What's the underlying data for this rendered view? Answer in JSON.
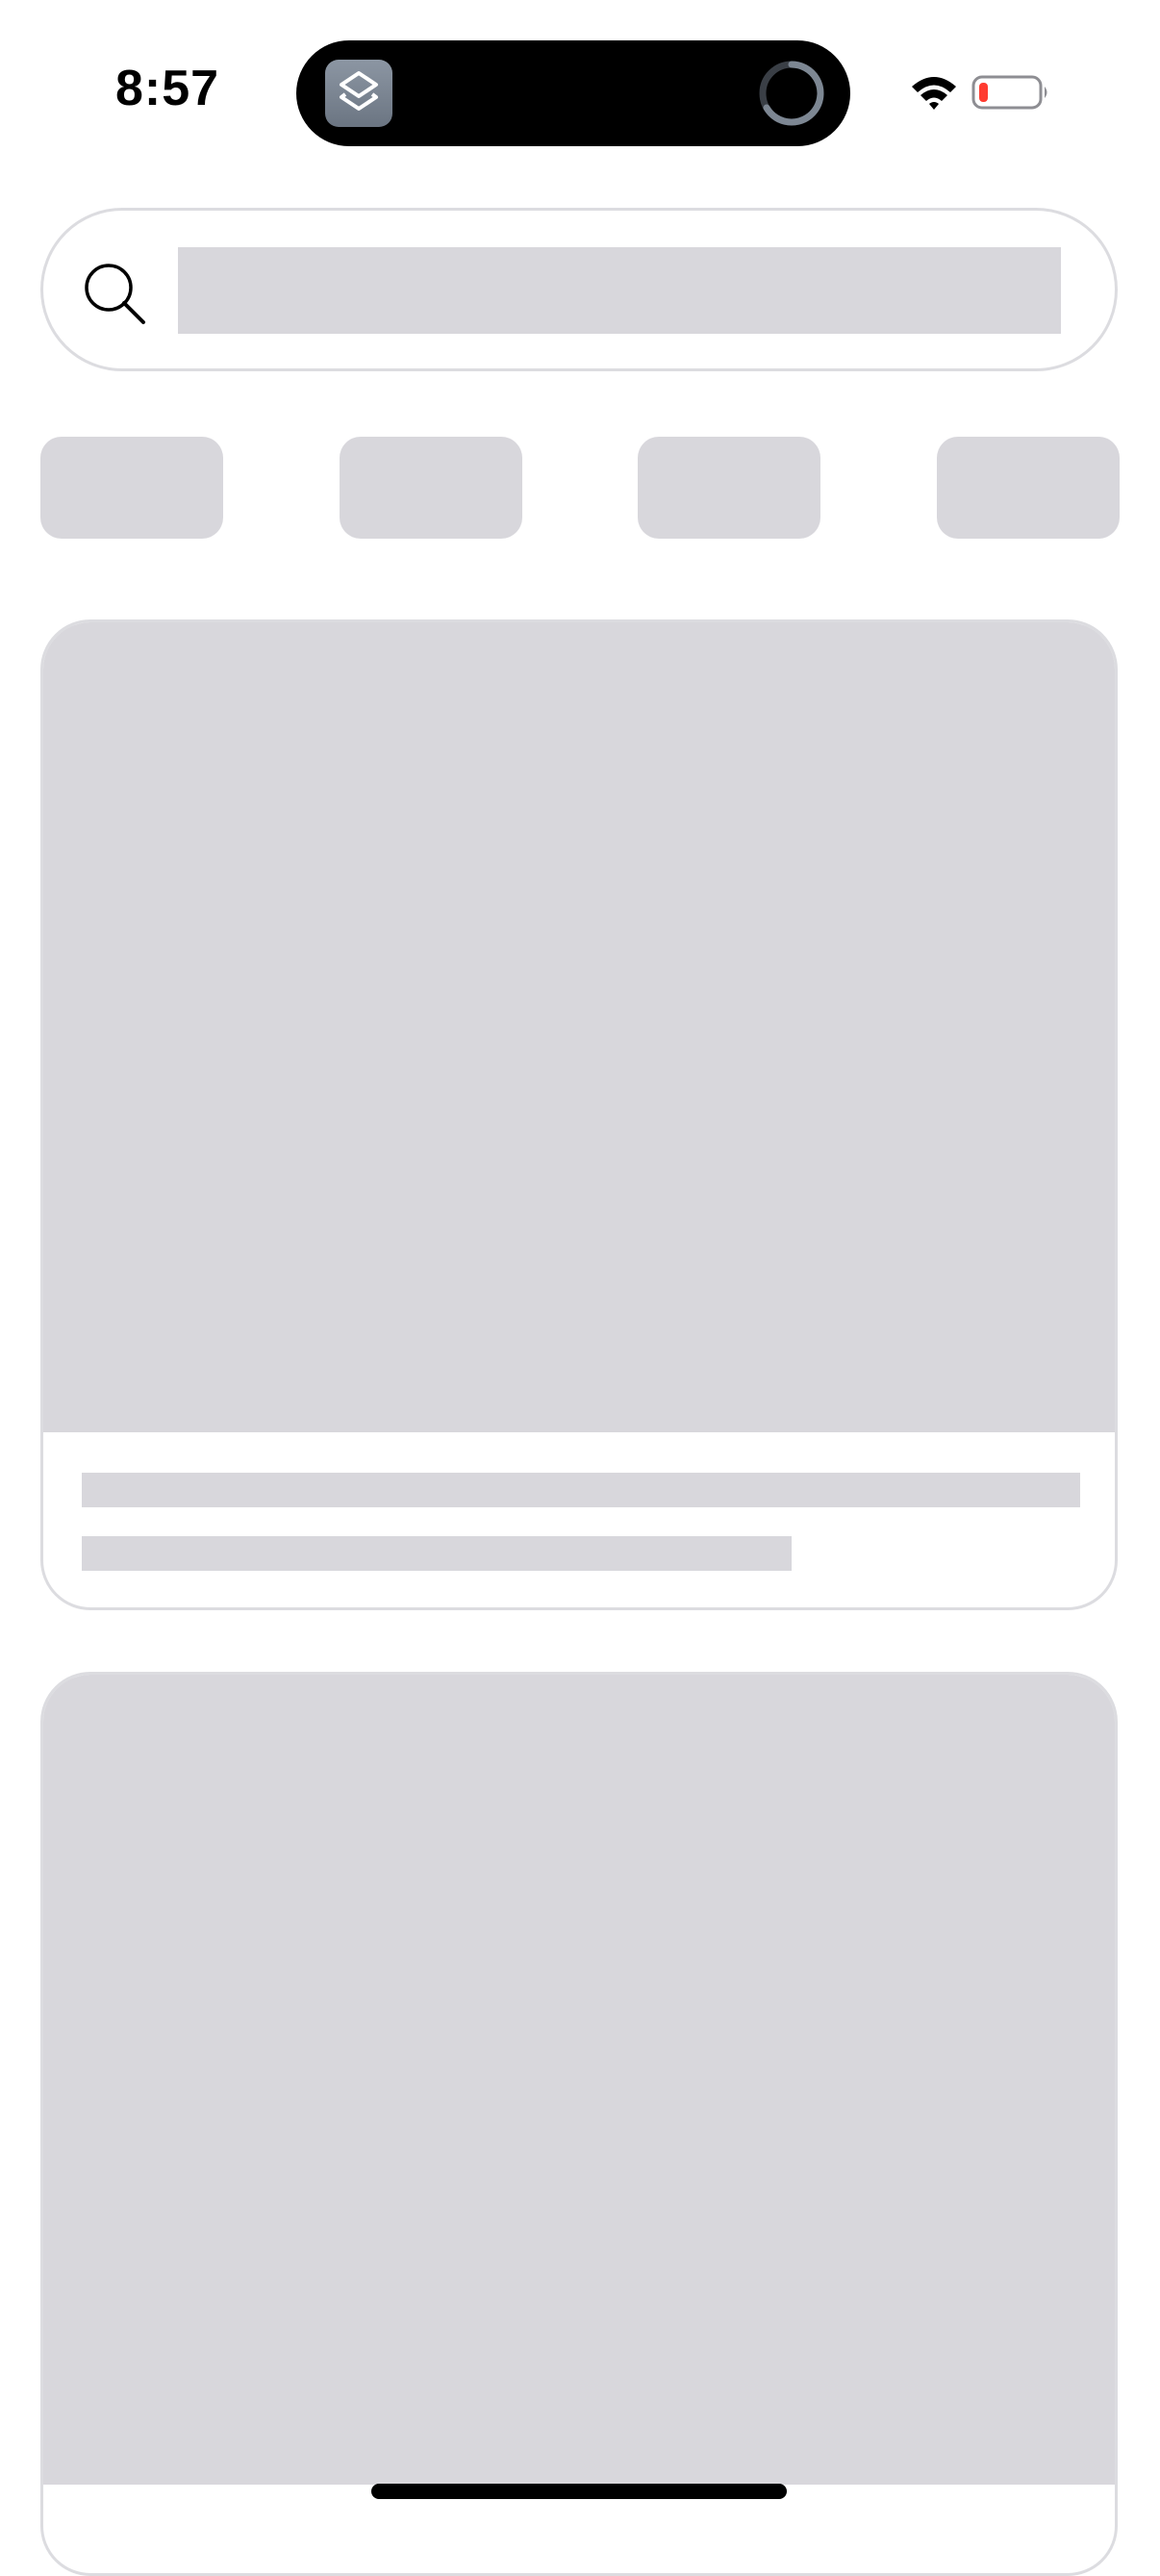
{
  "status_bar": {
    "time": "8:57",
    "battery_level": 0.1,
    "battery_color": "#ff3b30",
    "icons": [
      "wifi-icon",
      "battery-icon"
    ]
  },
  "dynamic_island": {
    "app_icon": "shortcuts-app-icon",
    "activity_icon": "progress-ring-icon"
  },
  "search": {
    "icon": "search-icon",
    "loading": true
  },
  "chips": {
    "count": 4,
    "loading": true
  },
  "cards": {
    "count": 2,
    "loading": true
  },
  "colors": {
    "skeleton": "#d8d7dc",
    "border": "#dcdce0",
    "background": "#ffffff"
  }
}
